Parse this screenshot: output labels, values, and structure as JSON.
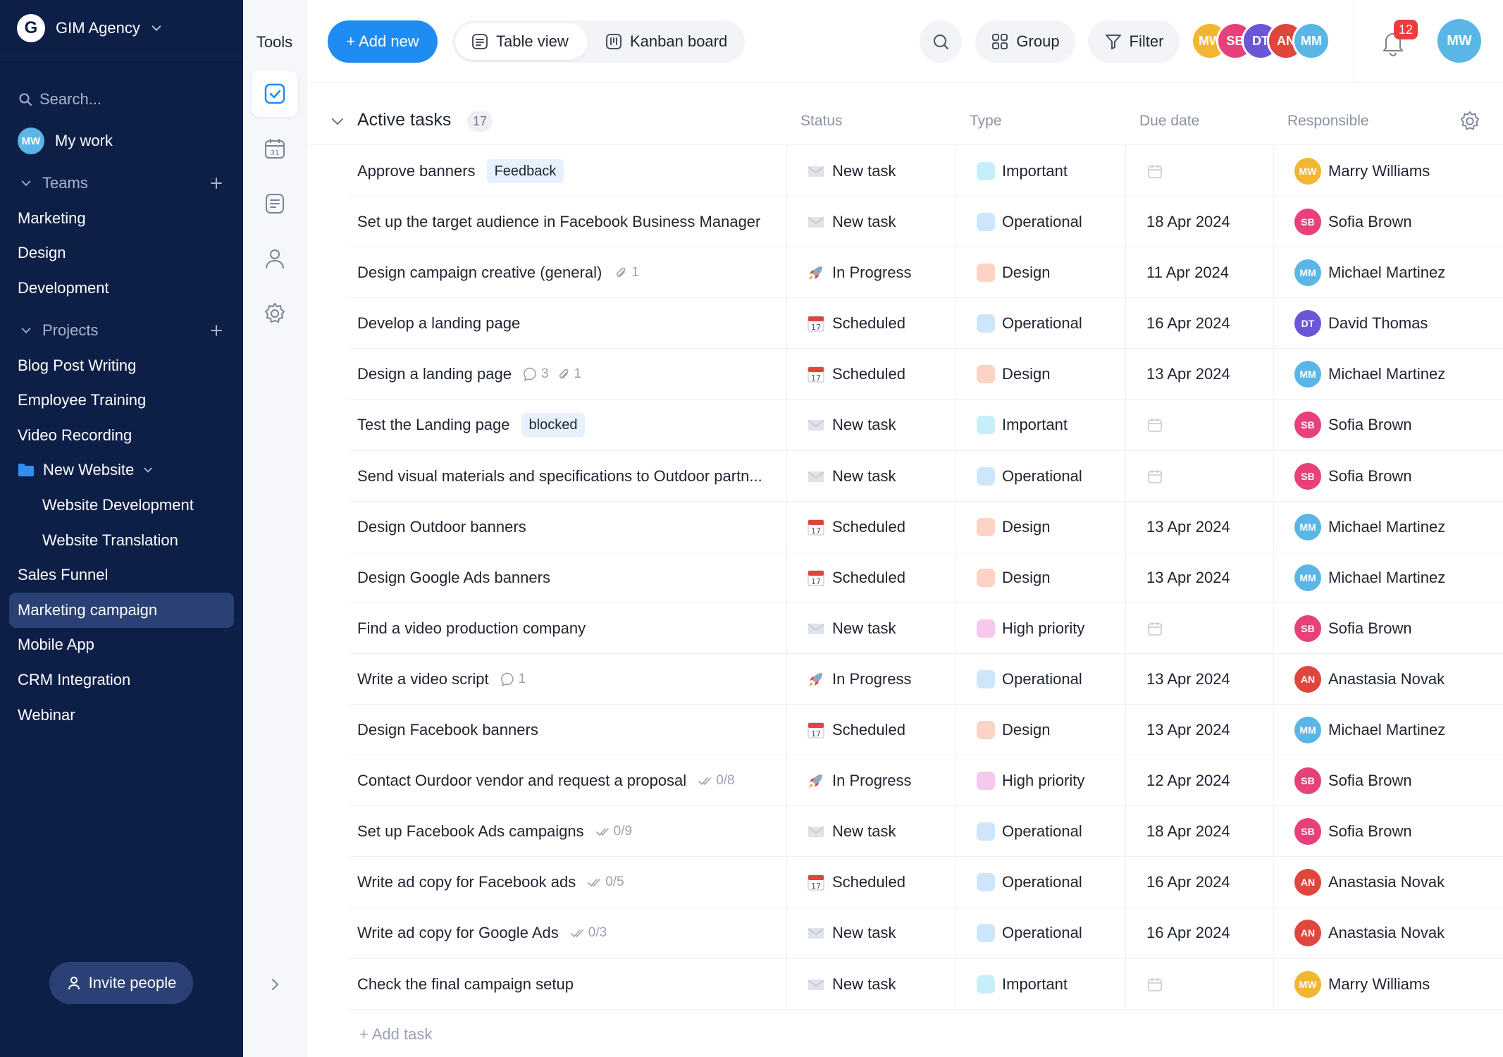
{
  "sidebar": {
    "brand_initial": "G",
    "brand_name": "GIM Agency",
    "search_placeholder": "Search...",
    "my_work": "My work",
    "my_work_avatar": "MW",
    "teams_label": "Teams",
    "teams": [
      "Marketing",
      "Design",
      "Development"
    ],
    "projects_label": "Projects",
    "projects": [
      "Blog Post Writing",
      "Employee Training",
      "Video Recording"
    ],
    "folder": "New Website",
    "folder_children": [
      "Website Development",
      "Website Translation"
    ],
    "projects_after": [
      "Sales Funnel",
      "Marketing campaign",
      "Mobile App",
      "CRM Integration",
      "Webinar"
    ],
    "active_project": "Marketing campaign",
    "invite_label": "Invite people"
  },
  "tools": {
    "title": "Tools",
    "items": [
      "checkbox-icon",
      "calendar-icon",
      "notes-icon",
      "user-icon",
      "settings-icon"
    ]
  },
  "toolbar": {
    "add_new": "+ Add new",
    "table_view": "Table view",
    "kanban_board": "Kanban board",
    "group": "Group",
    "filter": "Filter",
    "notification_count": "12",
    "team_avatars": [
      "MW",
      "SB",
      "DT",
      "AN",
      "MM"
    ]
  },
  "colors": {
    "accent": "#1e8cf0",
    "sidebar_bg": "#0e1f47",
    "sidebar_active": "#2b4074",
    "tag_bg": "#e6f1fd",
    "badge": "#ef3c3c",
    "type_important": "#c6effb",
    "type_operational": "#cde6fb",
    "type_design": "#fcd3c5",
    "type_high_priority": "#f6c8ee"
  },
  "tasks_section": {
    "title": "Active tasks",
    "count": "17",
    "columns": {
      "status": "Status",
      "type": "Type",
      "due": "Due date",
      "responsible": "Responsible"
    },
    "add_task": "+ Add task"
  },
  "tasks": [
    {
      "name": "Approve banners",
      "tag": "Feedback",
      "status": "New task",
      "status_icon": "envelope-icon",
      "type": "Important",
      "type_color": "#c6effb",
      "due": "",
      "responsible": "Marry Williams",
      "avatar_color": "#f2b632",
      "initials": "MW"
    },
    {
      "name": "Set up the target audience in Facebook Business Manager",
      "status": "New task",
      "status_icon": "envelope-icon",
      "type": "Operational",
      "type_color": "#cde6fb",
      "due": "18 Apr 2024",
      "responsible": "Sofia Brown",
      "avatar_color": "#e7407a",
      "initials": "SB"
    },
    {
      "name": "Design campaign creative (general)",
      "attachments": "1",
      "status": "In Progress",
      "status_icon": "rocket-icon",
      "type": "Design",
      "type_color": "#fcd3c5",
      "due": "11 Apr 2024",
      "responsible": "Michael Martinez",
      "avatar_color": "#5ab6e6",
      "initials": "MM"
    },
    {
      "name": "Develop a landing page",
      "status": "Scheduled",
      "status_icon": "calendar-17-icon",
      "type": "Operational",
      "type_color": "#cde6fb",
      "due": "16 Apr 2024",
      "responsible": "David Thomas",
      "avatar_color": "#6b57d6",
      "initials": "DT"
    },
    {
      "name": "Design a landing page",
      "comments": "3",
      "attachments": "1",
      "status": "Scheduled",
      "status_icon": "calendar-17-icon",
      "type": "Design",
      "type_color": "#fcd3c5",
      "due": "13 Apr 2024",
      "responsible": "Michael Martinez",
      "avatar_color": "#5ab6e6",
      "initials": "MM"
    },
    {
      "name": "Test the Landing page",
      "tag": "blocked",
      "status": "New task",
      "status_icon": "envelope-icon",
      "type": "Important",
      "type_color": "#c6effb",
      "due": "",
      "responsible": "Sofia Brown",
      "avatar_color": "#e7407a",
      "initials": "SB"
    },
    {
      "name": "Send visual materials and specifications to Outdoor partn...",
      "status": "New task",
      "status_icon": "envelope-icon",
      "type": "Operational",
      "type_color": "#cde6fb",
      "due": "",
      "responsible": "Sofia Brown",
      "avatar_color": "#e7407a",
      "initials": "SB"
    },
    {
      "name": "Design Outdoor banners",
      "status": "Scheduled",
      "status_icon": "calendar-17-icon",
      "type": "Design",
      "type_color": "#fcd3c5",
      "due": "13 Apr 2024",
      "responsible": "Michael Martinez",
      "avatar_color": "#5ab6e6",
      "initials": "MM"
    },
    {
      "name": "Design Google Ads banners",
      "status": "Scheduled",
      "status_icon": "calendar-17-icon",
      "type": "Design",
      "type_color": "#fcd3c5",
      "due": "13 Apr 2024",
      "responsible": "Michael Martinez",
      "avatar_color": "#5ab6e6",
      "initials": "MM"
    },
    {
      "name": "Find a video production company",
      "status": "New task",
      "status_icon": "envelope-icon",
      "type": "High priority",
      "type_color": "#f6c8ee",
      "due": "",
      "responsible": "Sofia Brown",
      "avatar_color": "#e7407a",
      "initials": "SB"
    },
    {
      "name": "Write a video script",
      "comments": "1",
      "status": "In Progress",
      "status_icon": "rocket-icon",
      "type": "Operational",
      "type_color": "#cde6fb",
      "due": "13 Apr 2024",
      "responsible": "Anastasia Novak",
      "avatar_color": "#e0463c",
      "initials": "AN"
    },
    {
      "name": "Design Facebook banners",
      "status": "Scheduled",
      "status_icon": "calendar-17-icon",
      "type": "Design",
      "type_color": "#fcd3c5",
      "due": "13 Apr 2024",
      "responsible": "Michael Martinez",
      "avatar_color": "#5ab6e6",
      "initials": "MM"
    },
    {
      "name": "Contact Ourdoor vendor and request a proposal",
      "subtasks": "0/8",
      "status": "In Progress",
      "status_icon": "rocket-icon",
      "type": "High priority",
      "type_color": "#f6c8ee",
      "due": "12 Apr 2024",
      "responsible": "Sofia Brown",
      "avatar_color": "#e7407a",
      "initials": "SB"
    },
    {
      "name": "Set up Facebook Ads campaigns",
      "subtasks": "0/9",
      "status": "New task",
      "status_icon": "envelope-icon",
      "type": "Operational",
      "type_color": "#cde6fb",
      "due": "18 Apr 2024",
      "responsible": "Sofia Brown",
      "avatar_color": "#e7407a",
      "initials": "SB"
    },
    {
      "name": "Write ad copy for Facebook ads",
      "subtasks": "0/5",
      "status": "Scheduled",
      "status_icon": "calendar-17-icon",
      "type": "Operational",
      "type_color": "#cde6fb",
      "due": "16 Apr 2024",
      "responsible": "Anastasia Novak",
      "avatar_color": "#e0463c",
      "initials": "AN"
    },
    {
      "name": "Write ad copy for Google Ads",
      "subtasks": "0/3",
      "status": "New task",
      "status_icon": "envelope-icon",
      "type": "Operational",
      "type_color": "#cde6fb",
      "due": "16 Apr 2024",
      "responsible": "Anastasia Novak",
      "avatar_color": "#e0463c",
      "initials": "AN"
    },
    {
      "name": "Check the final campaign setup",
      "status": "New task",
      "status_icon": "envelope-icon",
      "type": "Important",
      "type_color": "#c6effb",
      "due": "",
      "responsible": "Marry Williams",
      "avatar_color": "#f2b632",
      "initials": "MW"
    }
  ]
}
